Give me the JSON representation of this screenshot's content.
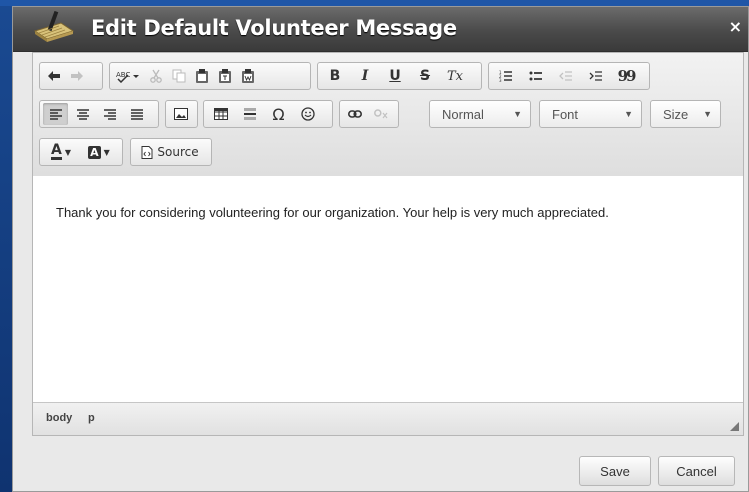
{
  "dialog": {
    "title": "Edit Default Volunteer Message",
    "close_symbol": "×"
  },
  "toolbar": {
    "row1_groups": [
      [
        "undo-icon",
        "redo-icon"
      ],
      [
        "spellcheck-icon",
        "cut-icon",
        "copy-icon",
        "paste-icon",
        "paste-text-icon",
        "paste-word-icon"
      ],
      [
        "bold-icon",
        "italic-icon",
        "underline-icon",
        "strikethrough-icon",
        "remove-format-icon"
      ],
      [
        "numbered-list-icon",
        "bulleted-list-icon",
        "decrease-indent-icon",
        "increase-indent-icon",
        "blockquote-icon"
      ]
    ],
    "format_label": "Normal",
    "font_label": "Font",
    "size_label": "Size",
    "source_label": "Source",
    "glyphs": {
      "bold": "B",
      "italic": "I",
      "underline": "U",
      "strike": "S",
      "removeformat": "Tx",
      "omega": "Ω",
      "blockquote": "99",
      "text_color": "A",
      "bg_color": "A"
    }
  },
  "editor": {
    "content": "Thank you for considering volunteering for our organization. Your help is very much appreciated.",
    "elements_path": [
      "body",
      "p"
    ]
  },
  "footer": {
    "save_label": "Save",
    "cancel_label": "Cancel"
  },
  "colors": {
    "titlebar": "#4a4a4a",
    "background": "#123a7a",
    "dialog": "#e9e9e9"
  }
}
